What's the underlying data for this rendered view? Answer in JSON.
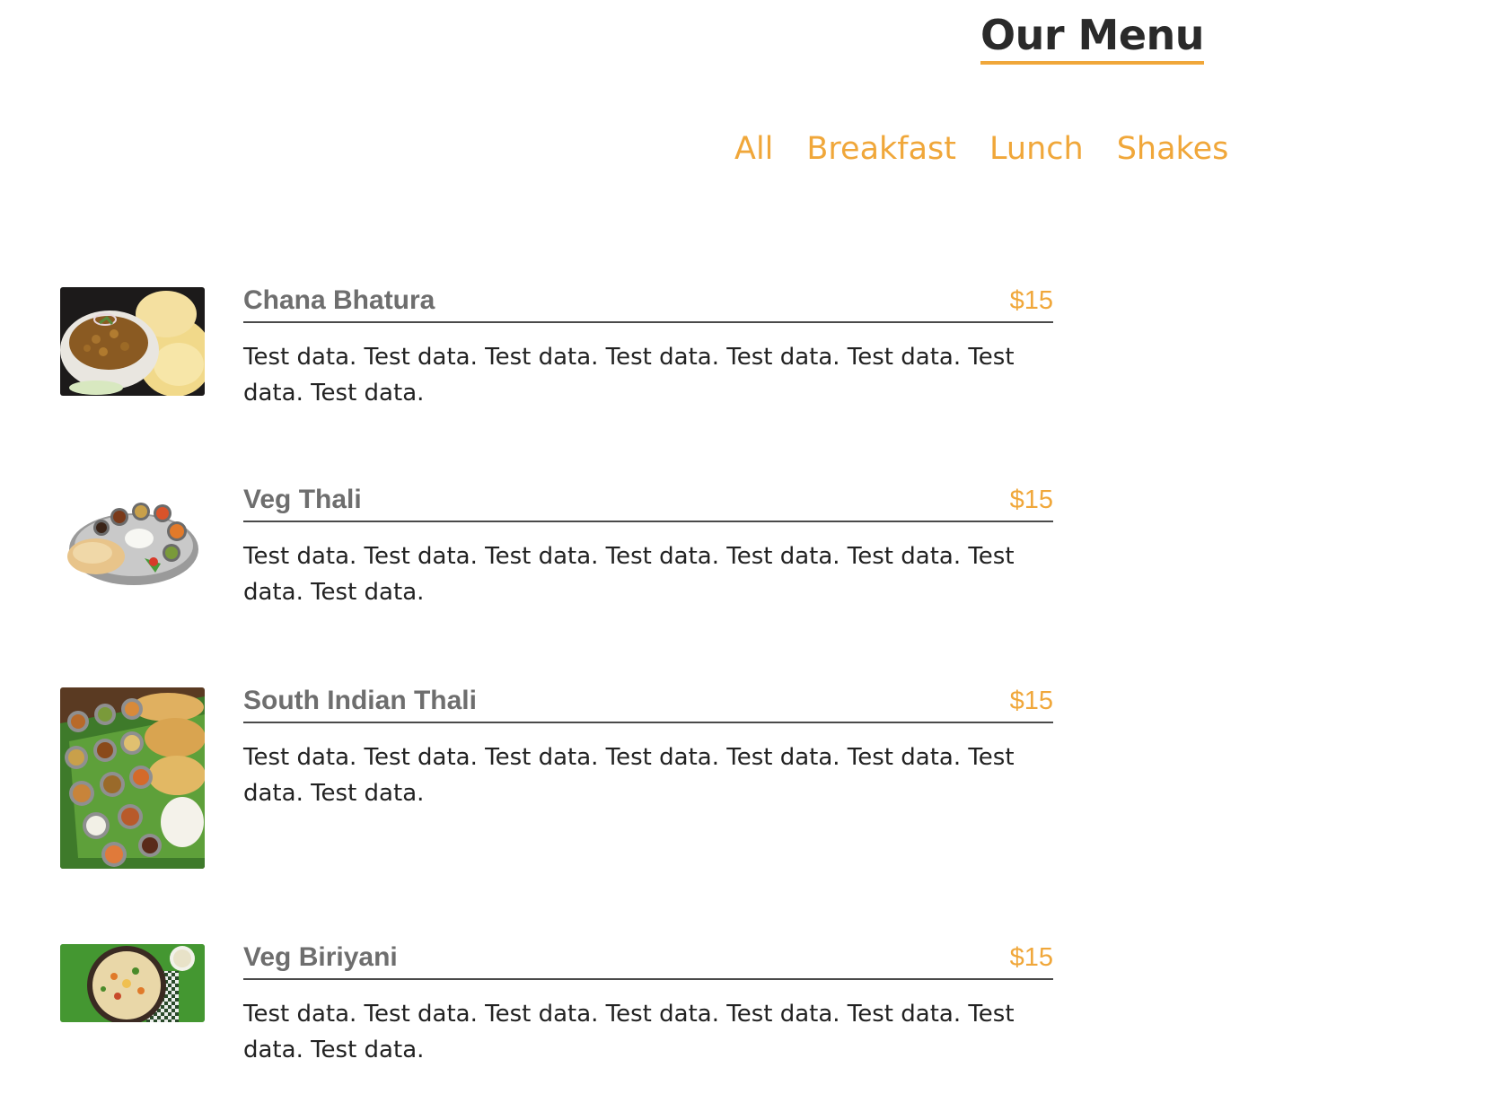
{
  "header": {
    "title": "Our Menu"
  },
  "tabs": [
    {
      "label": "All"
    },
    {
      "label": "Breakfast"
    },
    {
      "label": "Lunch"
    },
    {
      "label": "Shakes"
    }
  ],
  "colors": {
    "accent": "#f0a73a",
    "title": "#2a2a2a",
    "item_name": "#6e6e6e",
    "divider": "#4a4a4a",
    "body_text": "#222222"
  },
  "menu_items": [
    {
      "name": "Chana Bhatura",
      "price": "$15",
      "description": "Test data. Test data. Test data. Test data. Test data. Test data. Test data. Test data.",
      "image": "chana-bhatura-photo"
    },
    {
      "name": "Veg Thali",
      "price": "$15",
      "description": "Test data. Test data. Test data. Test data. Test data. Test data. Test data. Test data.",
      "image": "veg-thali-photo"
    },
    {
      "name": "South Indian Thali",
      "price": "$15",
      "description": "Test data. Test data. Test data. Test data. Test data. Test data. Test data. Test data.",
      "image": "south-indian-thali-photo"
    },
    {
      "name": "Veg Biriyani",
      "price": "$15",
      "description": "Test data. Test data. Test data. Test data. Test data. Test data. Test data. Test data.",
      "image": "veg-biriyani-photo"
    }
  ]
}
